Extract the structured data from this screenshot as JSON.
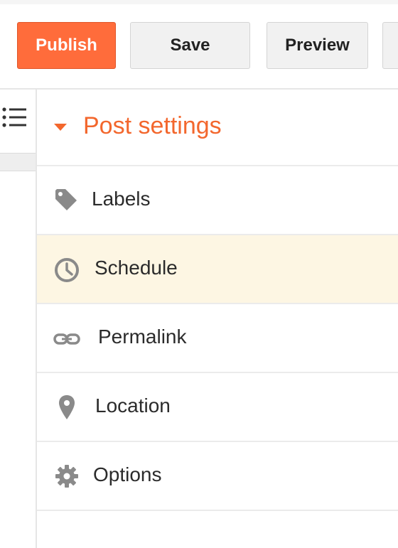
{
  "toolbar": {
    "publish_label": "Publish",
    "save_label": "Save",
    "preview_label": "Preview"
  },
  "colors": {
    "accent": "#f3672d",
    "publish_bg": "#ff6c3b",
    "active_row_bg": "#fdf6e3"
  },
  "panel": {
    "title": "Post settings",
    "items": [
      {
        "label": "Labels",
        "icon": "tag-icon"
      },
      {
        "label": "Schedule",
        "icon": "clock-icon",
        "active": true
      },
      {
        "label": "Permalink",
        "icon": "link-icon"
      },
      {
        "label": "Location",
        "icon": "location-pin-icon"
      },
      {
        "label": "Options",
        "icon": "gear-icon"
      }
    ]
  }
}
